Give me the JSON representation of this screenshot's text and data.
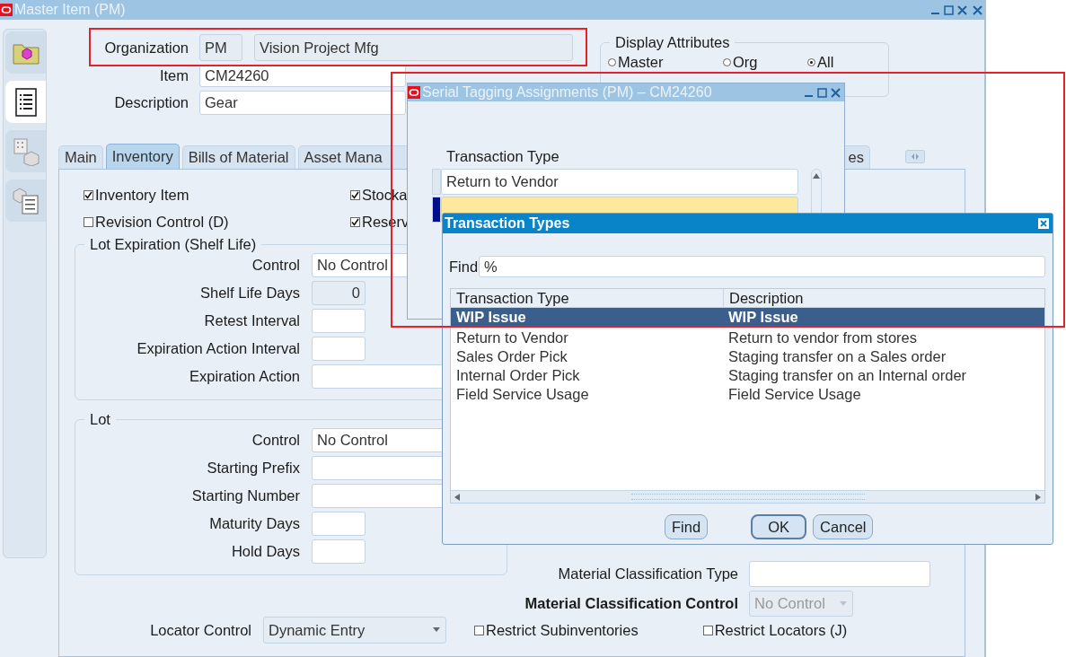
{
  "main_window": {
    "title": "Master Item (PM)"
  },
  "side_tabs": [
    {
      "selected": false
    },
    {
      "selected": true
    },
    {
      "selected": false
    },
    {
      "selected": false
    }
  ],
  "header": {
    "organization": {
      "label": "Organization",
      "code": "PM",
      "name": "Vision Project Mfg"
    },
    "item": {
      "label": "Item",
      "value": "CM24260"
    },
    "description": {
      "label": "Description",
      "value": "Gear"
    }
  },
  "display_attributes": {
    "title": "Display Attributes",
    "options": [
      {
        "label": "Master",
        "selected": false
      },
      {
        "label": "Org",
        "selected": false
      },
      {
        "label": "All",
        "selected": true
      }
    ]
  },
  "tabs": [
    {
      "label": "Main",
      "selected": false
    },
    {
      "label": "Inventory",
      "selected": true
    },
    {
      "label": "Bills of Material",
      "selected": false
    },
    {
      "label": "Asset Mana",
      "selected": false
    },
    {
      "label": "es",
      "selected": false
    }
  ],
  "checkboxes": [
    {
      "label": "Inventory Item",
      "checked": true
    },
    {
      "label": "Stocka",
      "checked": true
    },
    {
      "label": "Revision Control (D)",
      "checked": false
    },
    {
      "label": "Reserv",
      "checked": true
    }
  ],
  "lot_expiration": {
    "title": "Lot Expiration (Shelf Life)",
    "fields": [
      {
        "label": "Control",
        "value": "No Control",
        "kind": "readonly"
      },
      {
        "label": "Shelf Life Days",
        "value": "0",
        "kind": "number"
      },
      {
        "label": "Retest Interval",
        "kind": "short"
      },
      {
        "label": "Expiration Action Interval",
        "kind": "short"
      },
      {
        "label": "Expiration Action",
        "kind": "wide"
      }
    ]
  },
  "lot": {
    "title": "Lot",
    "fields": [
      {
        "label": "Control",
        "value": "No Control",
        "kind": "readonly"
      },
      {
        "label": "Starting Prefix",
        "kind": "wide"
      },
      {
        "label": "Starting Number",
        "kind": "wide"
      },
      {
        "label": "Maturity Days",
        "kind": "short"
      },
      {
        "label": "Hold Days",
        "kind": "short"
      }
    ]
  },
  "material": {
    "type_label": "Material Classification Type",
    "control_label": "Material Classification Control",
    "control_value": "No Control"
  },
  "locator_control": {
    "label": "Locator Control",
    "value": "Dynamic Entry"
  },
  "restrict": [
    {
      "label": "Restrict Subinventories",
      "checked": false
    },
    {
      "label": "Restrict Locators (J)",
      "checked": false
    }
  ],
  "serial_dialog": {
    "title": "Serial Tagging Assignments (PM) – CM24260",
    "column": "Transaction Type",
    "rows": [
      {
        "value": "Return to Vendor",
        "selected": false
      },
      {
        "selected": true
      }
    ]
  },
  "lov_dialog": {
    "title": "Transaction Types",
    "find_label": "Find",
    "find_value": "%",
    "columns": [
      "Transaction Type",
      "Description"
    ],
    "rows": [
      {
        "cells": [
          "WIP Issue",
          "WIP Issue"
        ],
        "selected": true
      },
      {
        "cells": [
          "Return to Vendor",
          "Return to vendor from stores"
        ],
        "selected": false
      },
      {
        "cells": [
          "Sales Order Pick",
          "Staging transfer on a Sales order"
        ],
        "selected": false
      },
      {
        "cells": [
          "Internal Order Pick",
          "Staging transfer on an Internal order"
        ],
        "selected": false
      },
      {
        "cells": [
          "Field Service Usage",
          "Field Service Usage"
        ],
        "selected": false
      }
    ],
    "buttons": [
      {
        "label": "Find",
        "default": false
      },
      {
        "label": "OK",
        "default": true
      },
      {
        "label": "Cancel",
        "default": false
      }
    ]
  }
}
